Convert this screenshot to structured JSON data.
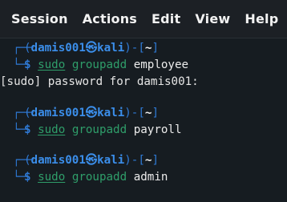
{
  "menu": {
    "session": "Session",
    "actions": "Actions",
    "edit": "Edit",
    "view": "View",
    "help": "Help"
  },
  "prompt": {
    "user_host": "damis001㉿kali",
    "user": "damis001",
    "at": "㉿",
    "host": "kali",
    "cwd": "~",
    "open_paren": "(",
    "close_paren_dash": ")-[",
    "close_bracket": "]",
    "corner_top": "┌──",
    "corner_bot": "└─",
    "dollar": "$"
  },
  "commands": [
    {
      "sudo": "sudo",
      "cmd": "groupadd",
      "arg": "employee"
    },
    {
      "sudo": "sudo",
      "cmd": "groupadd",
      "arg": "payroll"
    },
    {
      "sudo": "sudo",
      "cmd": "groupadd",
      "arg": "admin"
    }
  ],
  "outputs": {
    "password_prompt": "[sudo] password for damis001:"
  },
  "colors": {
    "prompt_blue": "#2f7ad6",
    "command_green": "#2f9e6a",
    "background": "#161c21"
  }
}
